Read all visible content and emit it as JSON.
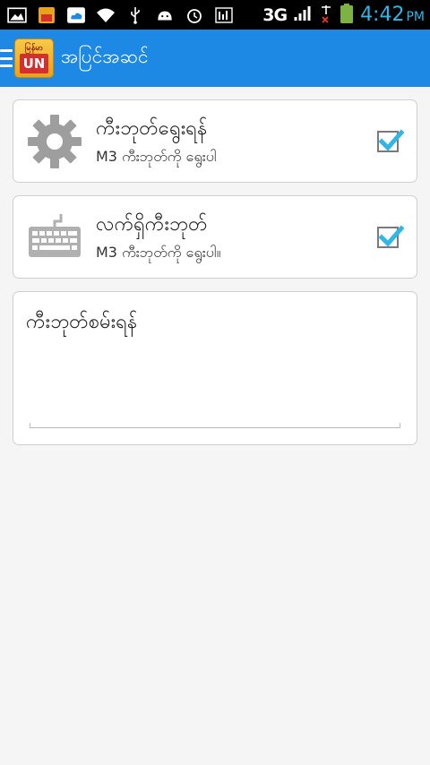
{
  "status_bar": {
    "network": "3G",
    "time": "4:42",
    "ampm": "PM"
  },
  "action_bar": {
    "logo_top": "မြန်မာ",
    "logo_mid": "UN",
    "title": "အပြင်အဆင်"
  },
  "settings": [
    {
      "title": "ကီးဘုတ်ရွေးရန်",
      "subtitle": "M3 ကီးဘုတ်ကို ရွေးပါ",
      "icon": "gear-icon",
      "checked": true
    },
    {
      "title": "လက်ရှိကီးဘုတ်",
      "subtitle": "M3 ကီးဘုတ်ကို ရွေးပါ။",
      "icon": "keyboard-icon",
      "checked": true
    }
  ],
  "test_area": {
    "title": "ကီးဘုတ်စမ်းရန်"
  },
  "colors": {
    "action_bar": "#1e88e5",
    "checkbox": "#33b5e5"
  }
}
